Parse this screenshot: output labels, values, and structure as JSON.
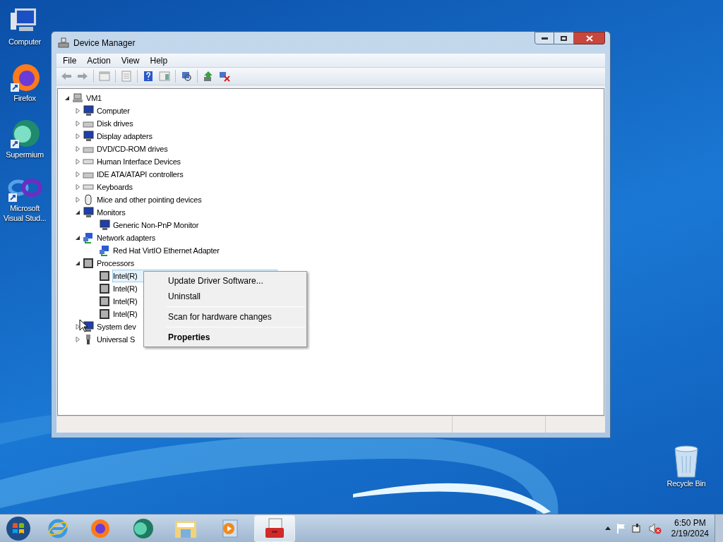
{
  "desktop_icons": [
    {
      "label": "Computer"
    },
    {
      "label": "Firefox"
    },
    {
      "label": "Supermium"
    },
    {
      "label": "Microsoft Visual Stud..."
    },
    {
      "label": "Recycle Bin"
    }
  ],
  "window": {
    "title": "Device Manager",
    "menu": [
      "File",
      "Action",
      "View",
      "Help"
    ],
    "tree": {
      "label": "VM1",
      "expanded": true,
      "selected": false,
      "children": [
        {
          "label": "Computer",
          "expanded": false,
          "selected": false
        },
        {
          "label": "Disk drives",
          "expanded": false,
          "selected": false
        },
        {
          "label": "Display adapters",
          "expanded": false,
          "selected": false
        },
        {
          "label": "DVD/CD-ROM drives",
          "expanded": false,
          "selected": false
        },
        {
          "label": "Human Interface Devices",
          "expanded": false,
          "selected": false
        },
        {
          "label": "IDE ATA/ATAPI controllers",
          "expanded": false,
          "selected": false
        },
        {
          "label": "Keyboards",
          "expanded": false,
          "selected": false
        },
        {
          "label": "Mice and other pointing devices",
          "expanded": false,
          "selected": false
        },
        {
          "label": "Monitors",
          "expanded": true,
          "selected": false,
          "children": [
            {
              "label": "Generic Non-PnP Monitor",
              "selected": false
            }
          ]
        },
        {
          "label": "Network adapters",
          "expanded": true,
          "selected": false,
          "children": [
            {
              "label": "Red Hat VirtIO Ethernet Adapter",
              "selected": false
            }
          ]
        },
        {
          "label": "Processors",
          "expanded": true,
          "selected": false,
          "children": [
            {
              "label": "Intel(R)",
              "selected": true
            },
            {
              "label": "Intel(R)",
              "selected": false
            },
            {
              "label": "Intel(R)",
              "selected": false
            },
            {
              "label": "Intel(R)",
              "selected": false
            }
          ]
        },
        {
          "label": "System dev",
          "expanded": false,
          "selected": false
        },
        {
          "label": "Universal S",
          "expanded": false,
          "selected": false
        }
      ]
    }
  },
  "context_menu": [
    {
      "kind": "item",
      "label": "Update Driver Software..."
    },
    {
      "kind": "item",
      "label": "Uninstall"
    },
    {
      "kind": "separator"
    },
    {
      "kind": "item",
      "label": "Scan for hardware changes"
    },
    {
      "kind": "separator"
    },
    {
      "kind": "default",
      "label": "Properties"
    }
  ],
  "taskbar": {
    "time": "6:50 PM",
    "date": "2/19/2024"
  }
}
